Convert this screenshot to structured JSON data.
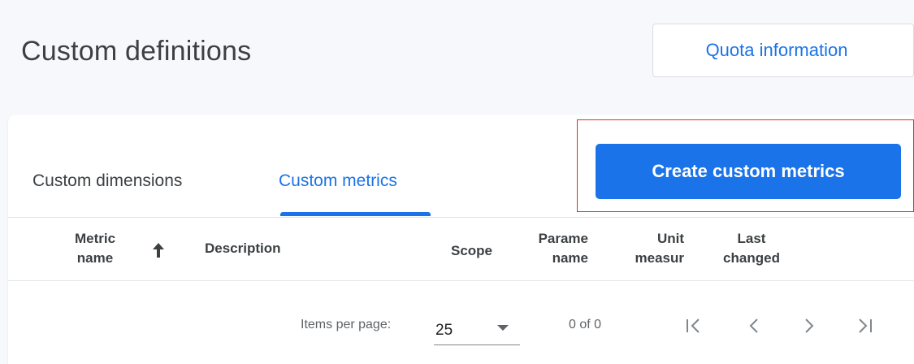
{
  "header": {
    "title": "Custom definitions",
    "quota_label": "Quota information"
  },
  "tabs": [
    {
      "label": "Custom dimensions",
      "active": false
    },
    {
      "label": "Custom metrics",
      "active": true
    }
  ],
  "create_button": {
    "label": "Create custom metrics",
    "highlighted": true
  },
  "table": {
    "columns": [
      {
        "lines": [
          "Metric",
          "name"
        ],
        "sorted": "ascending"
      },
      {
        "lines": [
          "Description"
        ]
      },
      {
        "lines": [
          "Scope"
        ]
      },
      {
        "lines": [
          "Parame",
          "name"
        ]
      },
      {
        "lines": [
          "Unit",
          "measur"
        ]
      },
      {
        "lines": [
          "Last",
          "changed"
        ]
      }
    ],
    "rows": []
  },
  "pagination": {
    "items_per_page_label": "Items per page:",
    "items_per_page_value": "25",
    "range_text": "0 of 0"
  },
  "icons": {
    "sort": "arrow-up-icon",
    "first_page": "first-page-icon",
    "previous_page": "chevron-left-icon",
    "next_page": "chevron-right-icon",
    "last_page": "last-page-icon"
  },
  "colors": {
    "accent": "#1a73e8",
    "highlight_border": "#d93025",
    "page_background": "#f7f8fb"
  }
}
